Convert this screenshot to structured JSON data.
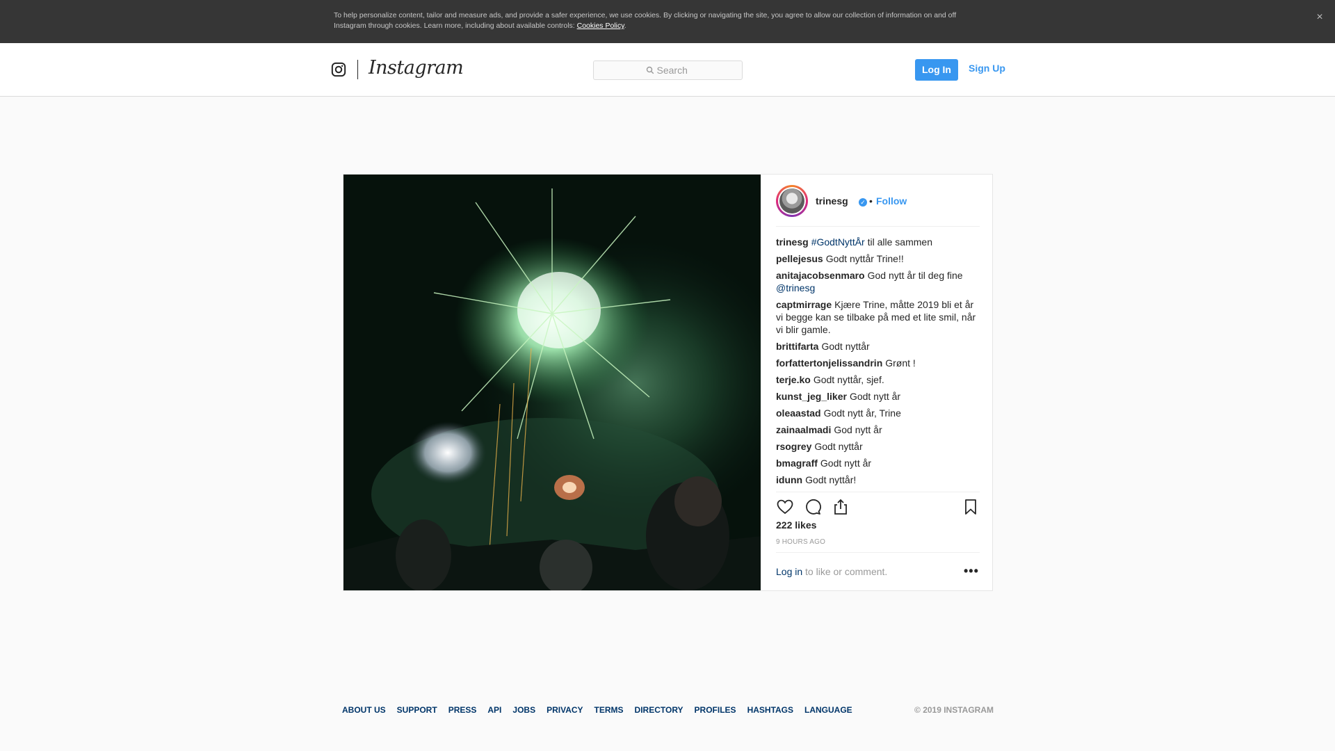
{
  "cookie_banner": {
    "text": "To help personalize content, tailor and measure ads, and provide a safer experience, we use cookies. By clicking or navigating the site, you agree to allow our collection of information on and off Instagram through cookies. Learn more, including about available controls: ",
    "link": "Cookies Policy",
    "close": "×"
  },
  "header": {
    "wordmark": "Instagram",
    "search_placeholder": "Search",
    "login_label": "Log In",
    "signup_label": "Sign Up"
  },
  "post": {
    "author": "trinesg",
    "verified_mark": "✓",
    "separator": "•",
    "follow_label": "Follow",
    "caption": {
      "user": "trinesg",
      "hashtag": "#GodtNyttÅr",
      "text": " til alle sammen"
    },
    "comments": [
      {
        "user": "pellejesus",
        "text": "Godt nyttår Trine!!"
      },
      {
        "user": "anitajacobsenmaro",
        "text": "God nytt år til deg fine ",
        "mention": "@trinesg",
        "tail": " "
      },
      {
        "user": "captmirrage",
        "text": "Kjære Trine, måtte 2019 bli et år vi begge kan se tilbake på med et lite smil, når vi blir gamle. "
      },
      {
        "user": "brittifarta",
        "text": "Godt nyttår  "
      },
      {
        "user": "forfattertonjelissandrin",
        "text": "Grønt !"
      },
      {
        "user": "terje.ko",
        "text": "Godt nyttår, sjef. "
      },
      {
        "user": "kunst_jeg_liker",
        "text": "Godt nytt år "
      },
      {
        "user": "oleaastad",
        "text": "Godt nytt år, Trine   "
      },
      {
        "user": "zainaalmadi",
        "text": "God nytt år"
      },
      {
        "user": "rsogrey",
        "text": "Godt nyttår"
      },
      {
        "user": "bmagraff",
        "text": "Godt nytt år"
      },
      {
        "user": "idunn",
        "text": "Godt nyttår!"
      }
    ],
    "likes": "222 likes",
    "time_ago": "9 HOURS AGO",
    "login_prompt": {
      "link": "Log in",
      "text": " to like or comment."
    },
    "more_label": "•••",
    "icons": [
      "heart-icon",
      "comment-icon",
      "share-icon",
      "bookmark-icon"
    ]
  },
  "footer": {
    "links": [
      "ABOUT US",
      "SUPPORT",
      "PRESS",
      "API",
      "JOBS",
      "PRIVACY",
      "TERMS",
      "DIRECTORY",
      "PROFILES",
      "HASHTAGS",
      "LANGUAGE"
    ],
    "copyright": "© 2019 INSTAGRAM"
  },
  "colors": {
    "accent": "#3897f0",
    "link_dark": "#003569",
    "banner_bg": "#363636"
  }
}
